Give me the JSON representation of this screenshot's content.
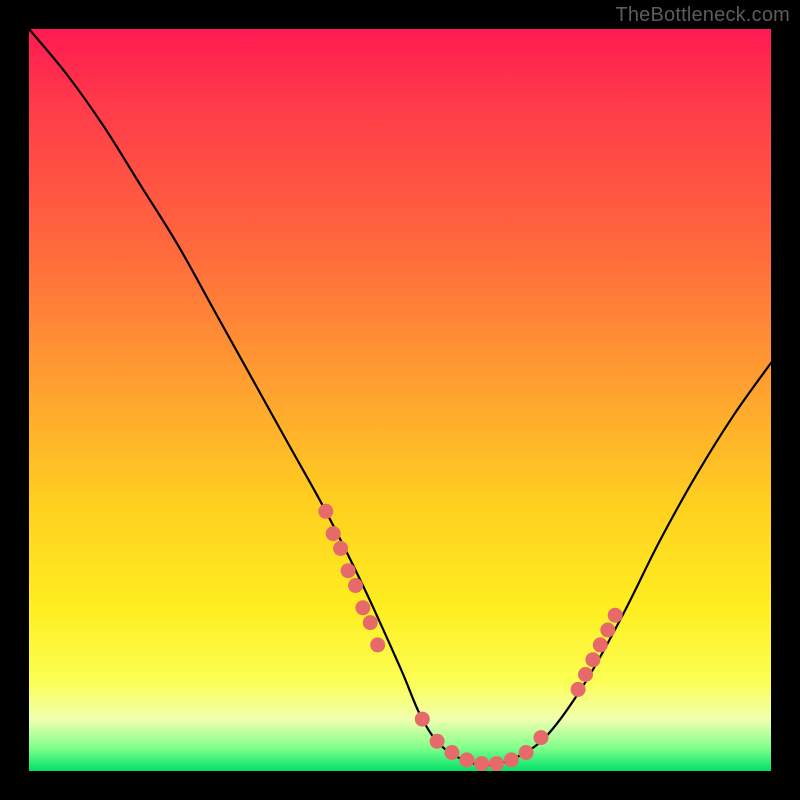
{
  "watermark": "TheBottleneck.com",
  "chart_data": {
    "type": "line",
    "title": "",
    "xlabel": "",
    "ylabel": "",
    "xlim": [
      0,
      100
    ],
    "ylim": [
      0,
      100
    ],
    "series": [
      {
        "name": "bottleneck-curve",
        "x": [
          0,
          5,
          10,
          15,
          20,
          25,
          30,
          35,
          40,
          45,
          50,
          53,
          56,
          60,
          63,
          66,
          70,
          75,
          80,
          85,
          90,
          95,
          100
        ],
        "y": [
          100,
          94,
          87,
          79,
          71,
          62,
          53,
          44,
          35,
          25,
          14,
          7,
          3,
          1,
          1,
          2,
          5,
          12,
          21,
          31,
          40,
          48,
          55
        ]
      }
    ],
    "highlight_clusters": [
      {
        "name": "left-cluster",
        "color": "#e76a6a",
        "points_xy": [
          [
            40,
            35
          ],
          [
            41,
            32
          ],
          [
            42,
            30
          ],
          [
            43,
            27
          ],
          [
            44,
            25
          ],
          [
            45,
            22
          ],
          [
            46,
            20
          ],
          [
            47,
            17
          ]
        ]
      },
      {
        "name": "trough-cluster",
        "color": "#e76a6a",
        "points_xy": [
          [
            53,
            7
          ],
          [
            55,
            4
          ],
          [
            57,
            2.5
          ],
          [
            59,
            1.5
          ],
          [
            61,
            1
          ],
          [
            63,
            1
          ],
          [
            65,
            1.5
          ],
          [
            67,
            2.5
          ],
          [
            69,
            4.5
          ]
        ]
      },
      {
        "name": "right-cluster",
        "color": "#e76a6a",
        "points_xy": [
          [
            74,
            11
          ],
          [
            75,
            13
          ],
          [
            76,
            15
          ],
          [
            77,
            17
          ],
          [
            78,
            19
          ],
          [
            79,
            21
          ]
        ]
      }
    ]
  }
}
